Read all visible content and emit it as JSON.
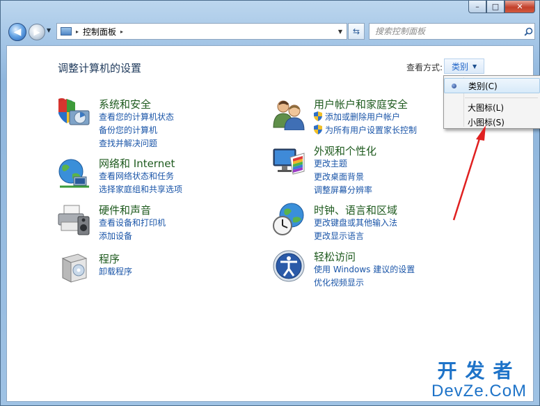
{
  "window": {
    "caption": {
      "minimize": "–",
      "maximize": "□",
      "close": "✕"
    }
  },
  "nav": {
    "back": "◀",
    "forward": "▶",
    "address": {
      "separator": "▸",
      "location": "控制面板",
      "separator_after": "▸"
    },
    "search": {
      "placeholder": "搜索控制面板"
    }
  },
  "content": {
    "title": "调整计算机的设置",
    "view_by": {
      "label": "查看方式:",
      "selected": "类别"
    },
    "view_menu": {
      "items": [
        {
          "label": "类别(C)",
          "checked": true
        },
        {
          "label": "大图标(L)",
          "checked": false
        },
        {
          "label": "小图标(S)",
          "checked": false
        }
      ]
    },
    "categories": [
      {
        "title": "系统和安全",
        "icon": "shield-icon",
        "links": [
          "查看您的计算机状态",
          "备份您的计算机",
          "查找并解决问题"
        ]
      },
      {
        "title": "网络和 Internet",
        "icon": "network-globe-icon",
        "links": [
          "查看网络状态和任务",
          "选择家庭组和共享选项"
        ]
      },
      {
        "title": "硬件和声音",
        "icon": "printer-icon",
        "links": [
          "查看设备和打印机",
          "添加设备"
        ]
      },
      {
        "title": "程序",
        "icon": "programs-box-icon",
        "links": [
          "卸载程序"
        ]
      },
      {
        "title": "用户帐户和家庭安全",
        "icon": "users-icon",
        "links": [
          "添加或删除用户帐户",
          "为所有用户设置家长控制"
        ]
      },
      {
        "title": "外观和个性化",
        "icon": "monitor-palette-icon",
        "links": [
          "更改主题",
          "更改桌面背景",
          "调整屏幕分辨率"
        ]
      },
      {
        "title": "时钟、语言和区域",
        "icon": "clock-globe-icon",
        "links": [
          "更改键盘或其他输入法",
          "更改显示语言"
        ]
      },
      {
        "title": "轻松访问",
        "icon": "ease-of-access-icon",
        "links": [
          "使用 Windows 建议的设置",
          "优化视频显示"
        ]
      }
    ]
  },
  "watermark": {
    "line1": "开发者",
    "line2": "DevZe.CoM"
  }
}
